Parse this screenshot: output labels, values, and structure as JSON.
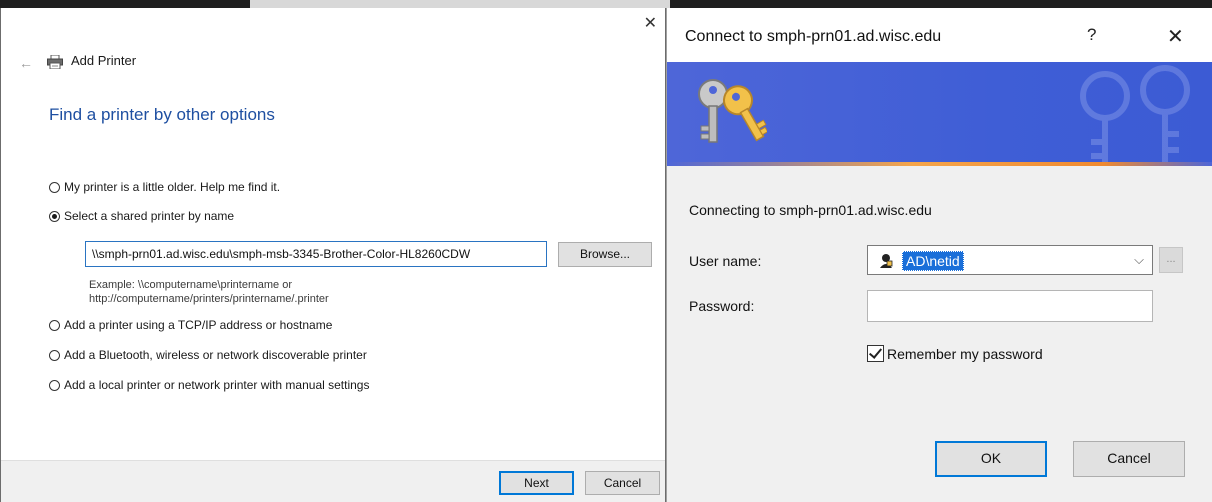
{
  "wizard": {
    "close_glyph": "✕",
    "back_glyph": "←",
    "header_title": "Add Printer",
    "heading": "Find a printer by other options",
    "options": [
      {
        "label": "My printer is a little older. Help me find it.",
        "selected": false
      },
      {
        "label": "Select a shared printer by name",
        "selected": true
      },
      {
        "label": "Add a printer using a TCP/IP address or hostname",
        "selected": false
      },
      {
        "label": "Add a Bluetooth, wireless or network discoverable printer",
        "selected": false
      },
      {
        "label": "Add a local printer or network printer with manual settings",
        "selected": false
      }
    ],
    "printer_path": "\\\\smph-prn01.ad.wisc.edu\\smph-msb-3345-Brother-Color-HL8260CDW",
    "browse_label": "Browse...",
    "example_line1": "Example: \\\\computername\\printername or",
    "example_line2": "http://computername/printers/printername/.printer",
    "next_label": "Next",
    "cancel_label": "Cancel"
  },
  "credentials": {
    "title": "Connect to smph-prn01.ad.wisc.edu",
    "help_glyph": "?",
    "close_glyph": "✕",
    "connecting_text": "Connecting to smph-prn01.ad.wisc.edu",
    "username_label": "User name:",
    "username_value": "AD\\netid",
    "password_label": "Password:",
    "password_value": "",
    "remember_label": "Remember my password",
    "remember_checked": true,
    "more_glyph": "...",
    "ok_label": "OK",
    "cancel_label": "Cancel"
  },
  "icons": {
    "back": "back-arrow-icon",
    "printer": "printer-icon",
    "keys": "keys-icon",
    "user": "user-icon",
    "dropdown": "chevron-down-icon"
  },
  "colors": {
    "heading_blue": "#1e4fa1",
    "banner_blue": "#4e66d8",
    "accent_orange": "#f5a54a",
    "focus_blue": "#0078d7",
    "selection_blue": "#1a6fd9"
  }
}
